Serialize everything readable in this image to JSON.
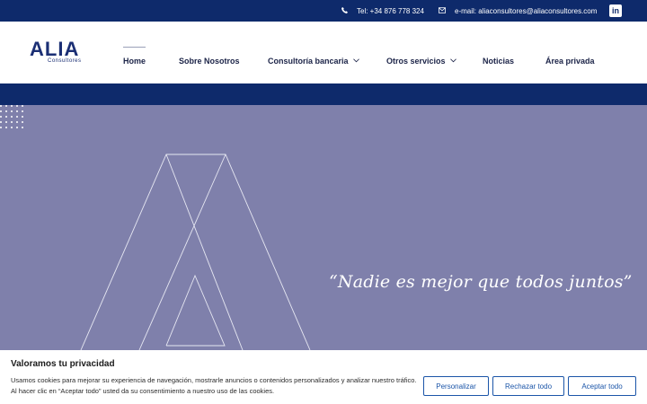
{
  "topbar": {
    "phone_icon": "phone-icon",
    "phone": "Tel: +34 876 778 324",
    "email_icon": "mail-icon",
    "email": "e-mail: aliaconsultores@aliaconsultores.com",
    "linkedin_icon": "linkedin-icon",
    "linkedin_glyph": "in"
  },
  "logo": {
    "name": "ALIA",
    "sub": "Consultores"
  },
  "nav": {
    "items": [
      {
        "label": "Home",
        "active": true
      },
      {
        "label": "Sobre Nosotros"
      },
      {
        "label": "Consultoría bancaria",
        "dropdown": true
      },
      {
        "label": "Otros servicios",
        "dropdown": true
      },
      {
        "label": "Noticias"
      },
      {
        "label": "Área privada"
      }
    ],
    "chevron": "⌄"
  },
  "hero": {
    "quote": "“Nadie es mejor que todos juntos”"
  },
  "cookie": {
    "title": "Valoramos tu privacidad",
    "text": "Usamos cookies para mejorar su experiencia de navegación, mostrarle anuncios o contenidos personalizados y analizar nuestro tráfico. Al hacer clic en “Aceptar todo” usted da su consentimiento a nuestro uso de las cookies.",
    "customize": "Personalizar",
    "reject": "Rechazar todo",
    "accept": "Aceptar todo"
  },
  "colors": {
    "brand_navy": "#0e2a6b",
    "hero_bg": "#7f80ab",
    "button_blue": "#1b55a8"
  }
}
